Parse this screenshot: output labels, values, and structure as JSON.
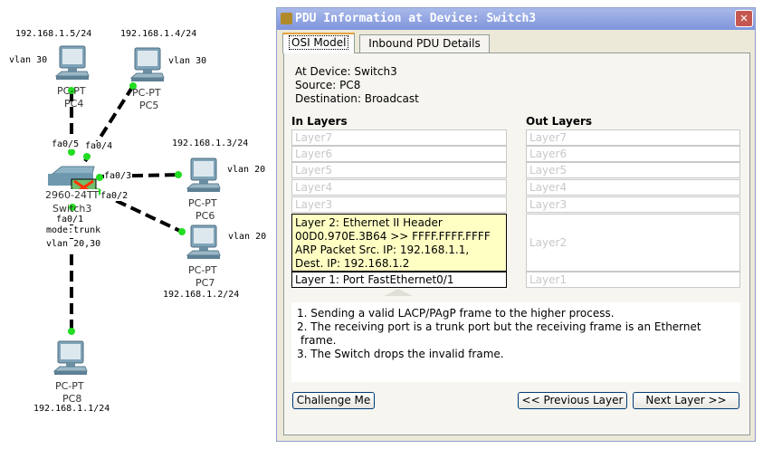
{
  "topology": {
    "labels": {
      "ip_pc4": "192.168.1.5/24",
      "ip_pc5": "192.168.1.4/24",
      "vlan_pc4": "vlan 30",
      "vlan_pc5": "vlan 30",
      "fa05": "fa0/5",
      "fa04": "fa0/4",
      "ip_pc6": "192.168.1.3/24",
      "vlan_pc6": "vlan 20",
      "fa03": "fa0/3",
      "fa02": "fa0/2",
      "fa01": "fa0/1",
      "mode": "mode:trunk",
      "vlan_trunk": "vlan 20,30",
      "vlan_pc7": "vlan 20",
      "ip_pc7": "192.168.1.2/24",
      "ip_pc8": "192.168.1.1/24"
    },
    "devices": {
      "pc4": {
        "model": "PC-PT",
        "name": "PC4"
      },
      "pc5": {
        "model": "PC-PT",
        "name": "PC5"
      },
      "pc6": {
        "model": "PC-PT",
        "name": "PC6"
      },
      "pc7": {
        "model": "PC-PT",
        "name": "PC7"
      },
      "pc8": {
        "model": "PC-PT",
        "name": "PC8"
      },
      "switch": {
        "model": "2960-24TT",
        "name": "Switch3"
      }
    },
    "link_color": "#00e000"
  },
  "dialog": {
    "title": "PDU Information at Device: Switch3",
    "close": "✕",
    "tabs": [
      "OSI Model",
      "Inbound PDU Details"
    ],
    "at_device": "At Device: Switch3",
    "source": "Source: PC8",
    "destination": "Destination: Broadcast",
    "in_header": "In Layers",
    "out_header": "Out Layers",
    "in_layers": [
      "Layer7",
      "Layer6",
      "Layer5",
      "Layer4",
      "Layer3"
    ],
    "in_layer2": [
      "Layer 2: Ethernet II Header",
      "00D0.970E.3B64 >> FFFF.FFFF.FFFF",
      "ARP Packet Src. IP: 192.168.1.1,",
      "Dest. IP: 192.168.1.2"
    ],
    "in_layer1": "Layer 1: Port FastEthernet0/1",
    "out_layers": [
      "Layer7",
      "Layer6",
      "Layer5",
      "Layer4",
      "Layer3",
      "Layer2",
      "Layer1"
    ],
    "description": [
      "1. Sending a valid LACP/PAgP frame to the higher process.",
      "2. The receiving port is a trunk port but the receiving frame is an Ethernet",
      "frame.",
      "3. The Switch drops the invalid frame."
    ],
    "buttons": {
      "challenge": "Challenge Me",
      "previous": "<< Previous Layer",
      "next": "Next Layer >>"
    }
  }
}
